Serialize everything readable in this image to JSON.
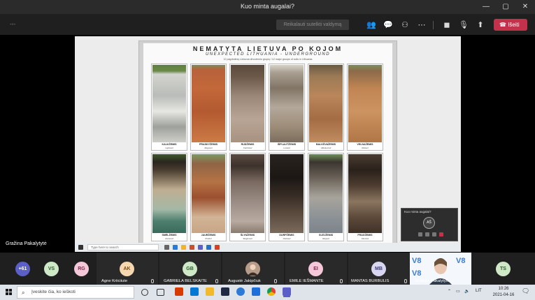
{
  "window": {
    "title": "Kuo minta augalai?"
  },
  "toolbar": {
    "timer_label": "Reikalauti sutelkti valdymą",
    "leave_label": "Išeiti"
  },
  "stage": {
    "presenter_name": "Gražina Pakalytytė"
  },
  "poster": {
    "title": "NEMATYTA LIETUVA PO KOJOM",
    "subtitle": "UNEXPECTED LITHUANIA - UNDERGROUND",
    "note": "12 pagrindinių Lietuvos dirvožemio grupių / 12 major groups of soils in Lithuania",
    "soils": [
      {
        "name": "KALKŽEMIS",
        "latin": "Leptosol"
      },
      {
        "name": "PRASKYŽEMIS",
        "latin": "Regosol"
      },
      {
        "name": "RUDŽEMIS",
        "latin": "Cambisol"
      },
      {
        "name": "IŠPLAUTŽEMIS",
        "latin": "Luvisol"
      },
      {
        "name": "BALKŠVAŽEMIS",
        "latin": "Albeluvisol"
      },
      {
        "name": "VELNAŽEMIS",
        "latin": "Retisol"
      },
      {
        "name": "SMĖLŽEMIS",
        "latin": "Arenosol"
      },
      {
        "name": "JAURŽEMIS",
        "latin": "Podzol"
      },
      {
        "name": "ŠLYNŽEMIS",
        "latin": "Stagnosol"
      },
      {
        "name": "DURPŽEMIS",
        "latin": "Histosol"
      },
      {
        "name": "GLĖJŽEMIS",
        "latin": "Gleysol"
      },
      {
        "name": "FRAGŽEMIS",
        "latin": "Fluvisol"
      }
    ]
  },
  "inner_taskbar": {
    "search_placeholder": "Type here to search"
  },
  "mini_window": {
    "title": "Kuo minta augalai?",
    "avatar_initials": "AŠ"
  },
  "participants": [
    {
      "initials": "+61",
      "name": "",
      "color": "#5b5fc7"
    },
    {
      "initials": "VS",
      "name": "",
      "color": "#cfe8c8"
    },
    {
      "initials": "RG",
      "name": "",
      "color": "#f4c8d8"
    },
    {
      "initials": "AK",
      "name": "Agne Kriiciiute",
      "color": "#f6d7b0"
    },
    {
      "initials": "GB",
      "name": "GABRIELA BELSKAITE",
      "color": "#cfe8c8"
    },
    {
      "initials": "",
      "name": "Augustė Jakipčiuk",
      "color": "#8a6d5c"
    },
    {
      "initials": "EI",
      "name": "EMILE IEŠMANTE",
      "color": "#f4c8d8"
    },
    {
      "initials": "MB",
      "name": "MANTAS BURBULIS",
      "color": "#d9d6f2"
    },
    {
      "initials": "",
      "name": "Gražina Pakalytytė",
      "color": "#ffffff"
    },
    {
      "initials": "TS",
      "name": "",
      "color": "#cfe8c8"
    }
  ],
  "taskbar": {
    "search_placeholder": "Įveskite čia, ko ieškoti",
    "lang": "LIT",
    "time": "10:26",
    "date": "2021-04-16"
  }
}
